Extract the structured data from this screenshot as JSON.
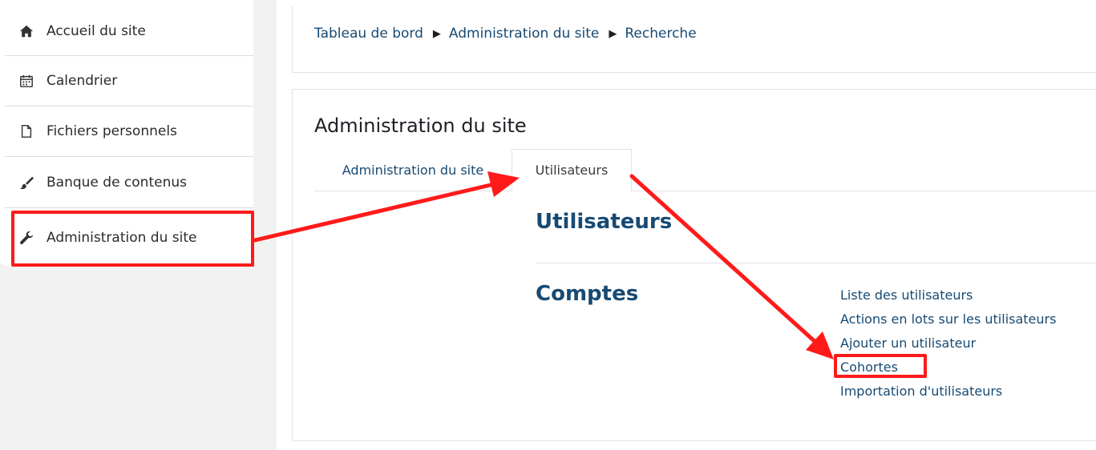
{
  "sidebar": {
    "items": [
      {
        "label": "Accueil du site",
        "icon": "home-icon"
      },
      {
        "label": "Calendrier",
        "icon": "calendar-icon"
      },
      {
        "label": "Fichiers personnels",
        "icon": "file-icon"
      },
      {
        "label": "Banque de contenus",
        "icon": "brush-icon"
      },
      {
        "label": "Administration du site",
        "icon": "wrench-icon"
      }
    ]
  },
  "breadcrumb": {
    "items": [
      "Tableau de bord",
      "Administration du site",
      "Recherche"
    ],
    "separator": "▶"
  },
  "main": {
    "title": "Administration du site",
    "tabs": [
      {
        "label": "Administration du site",
        "active": false
      },
      {
        "label": "Utilisateurs",
        "active": true
      }
    ],
    "section_title": "Utilisateurs",
    "subsection_title": "Comptes",
    "links": [
      "Liste des utilisateurs",
      "Actions en lots sur les utilisateurs",
      "Ajouter un utilisateur",
      "Cohortes",
      "Importation d'utilisateurs"
    ]
  },
  "colors": {
    "link": "#174a73",
    "highlight": "#ff1a1a",
    "sidebar_bg": "#f2f2f2"
  }
}
